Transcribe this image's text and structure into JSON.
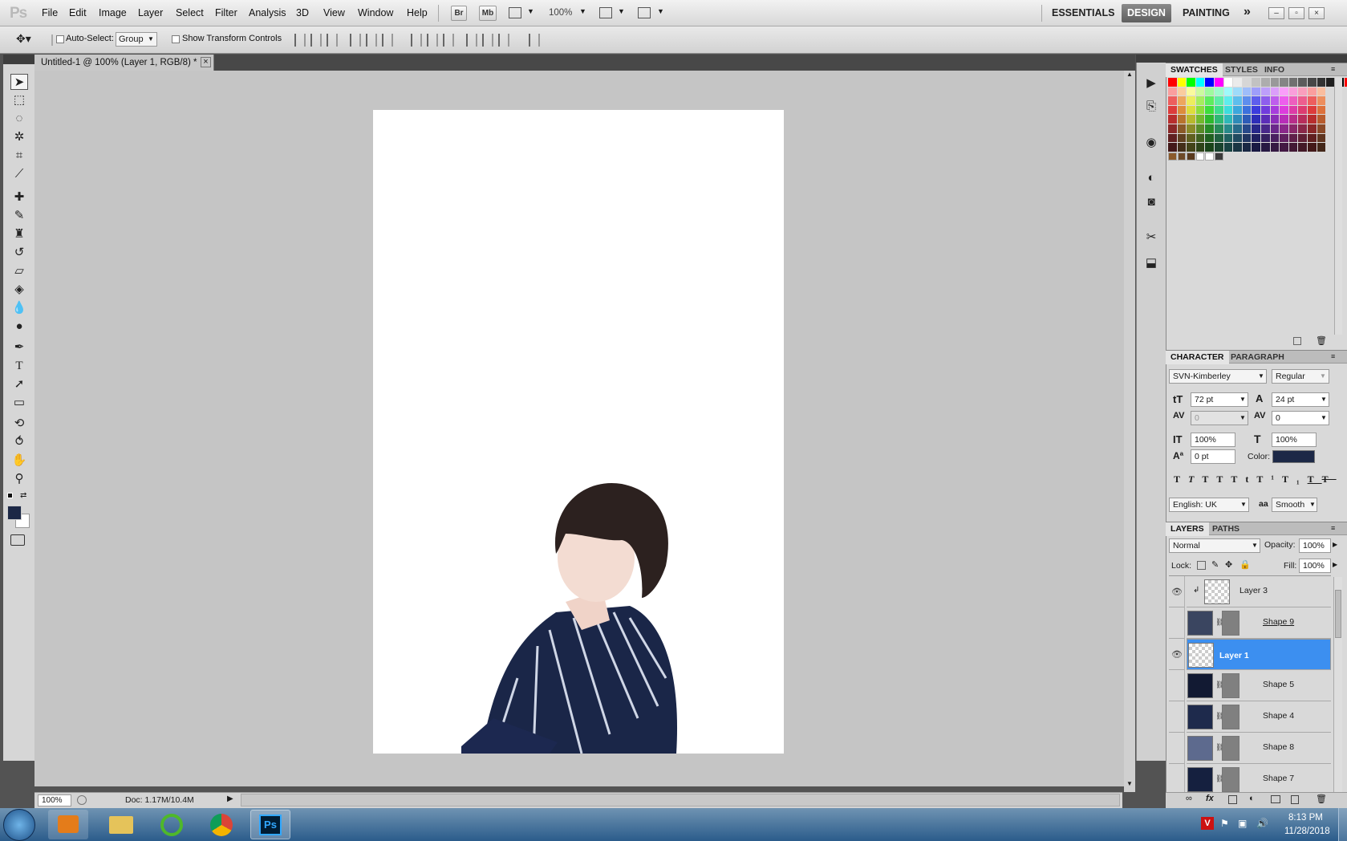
{
  "app": {
    "logo": "Ps"
  },
  "menu": [
    "File",
    "Edit",
    "Image",
    "Layer",
    "Select",
    "Filter",
    "Analysis",
    "3D",
    "View",
    "Window",
    "Help"
  ],
  "appbar": {
    "bridge": "Br",
    "minibridge": "Mb",
    "zoom": "100%"
  },
  "workspaces": [
    "ESSENTIALS",
    "DESIGN",
    "PAINTING"
  ],
  "more_workspaces": "»",
  "options": {
    "auto_select_label": "Auto-Select:",
    "auto_select_value": "Group",
    "transform_label": "Show Transform Controls"
  },
  "document": {
    "tab_title": "Untitled-1 @ 100% (Layer 1, RGB/8) *",
    "close": "×"
  },
  "status": {
    "zoom": "100%",
    "doc": "Doc: 1.17M/10.4M"
  },
  "swatches_panel": {
    "tabs": [
      "SWATCHES",
      "STYLES",
      "INFO"
    ]
  },
  "character_panel": {
    "tabs": [
      "CHARACTER",
      "PARAGRAPH"
    ],
    "font": "SVN-Kimberley",
    "style": "Regular",
    "size": "72 pt",
    "leading": "24 pt",
    "kerning": "0",
    "tracking": "0",
    "vscale": "100%",
    "hscale": "100%",
    "baseline": "0 pt",
    "color_label": "Color:",
    "color": "#1c2846",
    "language": "English: UK",
    "aa_label": "aa",
    "aa": "Smooth",
    "format_buttons": [
      "T",
      "T",
      "TT",
      "Tt",
      "T¹",
      "T₁",
      "T",
      "T"
    ]
  },
  "layers_panel": {
    "tabs": [
      "LAYERS",
      "PATHS"
    ],
    "blend": "Normal",
    "opacity_label": "Opacity:",
    "opacity": "100%",
    "lock_label": "Lock:",
    "fill_label": "Fill:",
    "fill": "100%",
    "layers": [
      {
        "name": "Layer 3",
        "visible": true,
        "selected": false,
        "thumb": "transparent"
      },
      {
        "name": "Shape 9",
        "visible": false,
        "selected": false,
        "thumb": "#3a4560"
      },
      {
        "name": "Layer 1",
        "visible": true,
        "selected": true,
        "thumb": "transparent"
      },
      {
        "name": "Shape 5",
        "visible": false,
        "selected": false,
        "thumb": "#121a33"
      },
      {
        "name": "Shape 4",
        "visible": false,
        "selected": false,
        "thumb": "#1e2a4c"
      },
      {
        "name": "Shape 8",
        "visible": false,
        "selected": false,
        "thumb": "#5d6a8e"
      },
      {
        "name": "Shape 7",
        "visible": false,
        "selected": false,
        "thumb": "#15203f"
      }
    ]
  },
  "taskbar": {
    "time": "8:13 PM",
    "date": "11/28/2018"
  },
  "colors": {
    "foreground": "#1c2846",
    "background": "#ffffff",
    "selection": "#3c8ff0"
  }
}
